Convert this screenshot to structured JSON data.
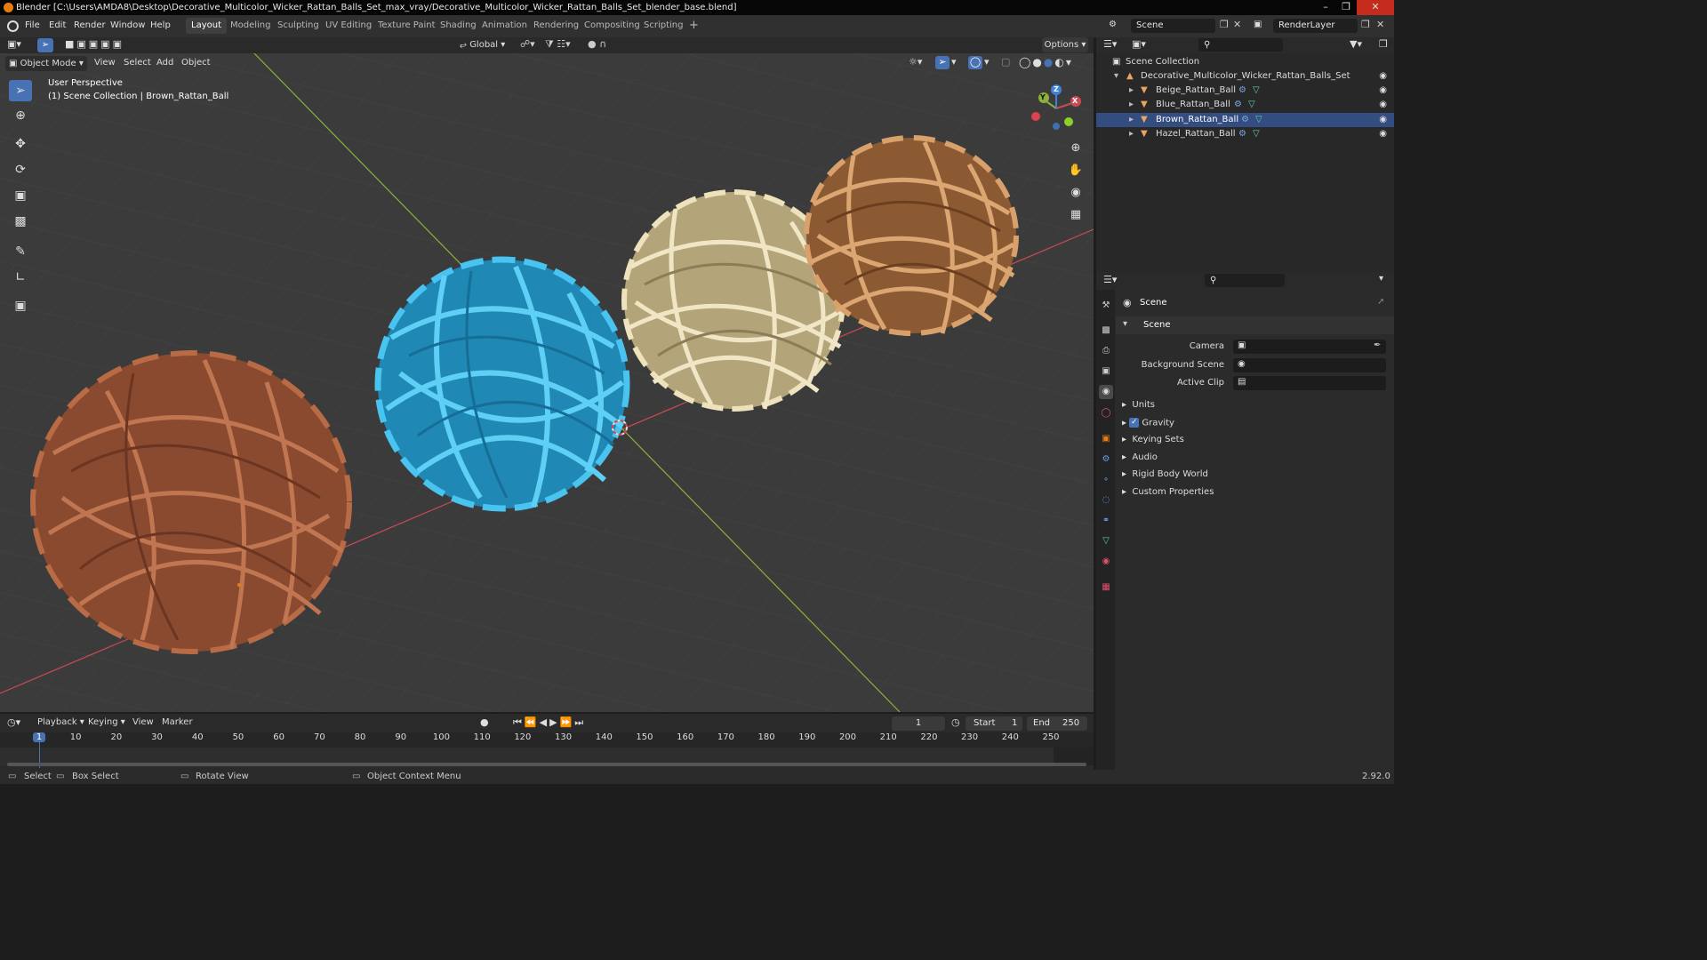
{
  "window": {
    "title": "Blender [C:\\Users\\AMDA8\\Desktop\\Decorative_Multicolor_Wicker_Rattan_Balls_Set_max_vray/Decorative_Multicolor_Wicker_Rattan_Balls_Set_blender_base.blend]"
  },
  "menu": [
    "File",
    "Edit",
    "Render",
    "Window",
    "Help"
  ],
  "workspaces": [
    "Layout",
    "Modeling",
    "Sculpting",
    "UV Editing",
    "Texture Paint",
    "Shading",
    "Animation",
    "Rendering",
    "Compositing",
    "Scripting"
  ],
  "active_workspace": "Layout",
  "scene": {
    "name": "Scene",
    "render_layer": "RenderLayer"
  },
  "viewport_header": {
    "orientation": "Global",
    "options": "Options",
    "mode": "Object Mode",
    "menus": [
      "View",
      "Select",
      "Add",
      "Object"
    ]
  },
  "viewport": {
    "perspective": "User Perspective",
    "collection_info": "(1) Scene Collection | Brown_Rattan_Ball",
    "balls": [
      {
        "name": "brown",
        "color": "#a35a38"
      },
      {
        "name": "blue",
        "color": "#3ab2dd"
      },
      {
        "name": "beige",
        "color": "#ddd0a8"
      },
      {
        "name": "hazel",
        "color": "#c28a55"
      }
    ],
    "gizmo": {
      "x": "X",
      "y": "Y",
      "z": "Z"
    }
  },
  "outliner": {
    "root": "Scene Collection",
    "collection": "Decorative_Multicolor_Wicker_Rattan_Balls_Set",
    "objects": [
      "Beige_Rattan_Ball",
      "Blue_Rattan_Ball",
      "Brown_Rattan_Ball",
      "Hazel_Rattan_Ball"
    ]
  },
  "properties": {
    "context": "Scene",
    "panel": "Scene",
    "fields": [
      {
        "label": "Camera"
      },
      {
        "label": "Background Scene"
      },
      {
        "label": "Active Clip"
      }
    ],
    "subpanels": [
      "Units",
      "Gravity",
      "Keying Sets",
      "Audio",
      "Rigid Body World",
      "Custom Properties"
    ],
    "gravity_checked": true
  },
  "timeline": {
    "menus": [
      "Playback",
      "Keying",
      "View",
      "Marker"
    ],
    "current_frame": "1",
    "start_label": "Start",
    "start": "1",
    "end_label": "End",
    "end": "250",
    "ticks": [
      "1",
      "10",
      "20",
      "30",
      "40",
      "50",
      "60",
      "70",
      "80",
      "90",
      "100",
      "110",
      "120",
      "130",
      "140",
      "150",
      "160",
      "170",
      "180",
      "190",
      "200",
      "210",
      "220",
      "230",
      "240",
      "250"
    ]
  },
  "statusbar": {
    "select": "Select",
    "box_select": "Box Select",
    "rotate_view": "Rotate View",
    "context_menu": "Object Context Menu",
    "version": "2.92.0"
  },
  "colors": {
    "accent": "#4772b3",
    "selection": "#334d80",
    "viewport_bg": "#3b3b3b",
    "x_axis": "#c94a55",
    "y_axis": "#8bb13a",
    "z_axis": "#3f82d6",
    "orange": "#e87d0d"
  }
}
